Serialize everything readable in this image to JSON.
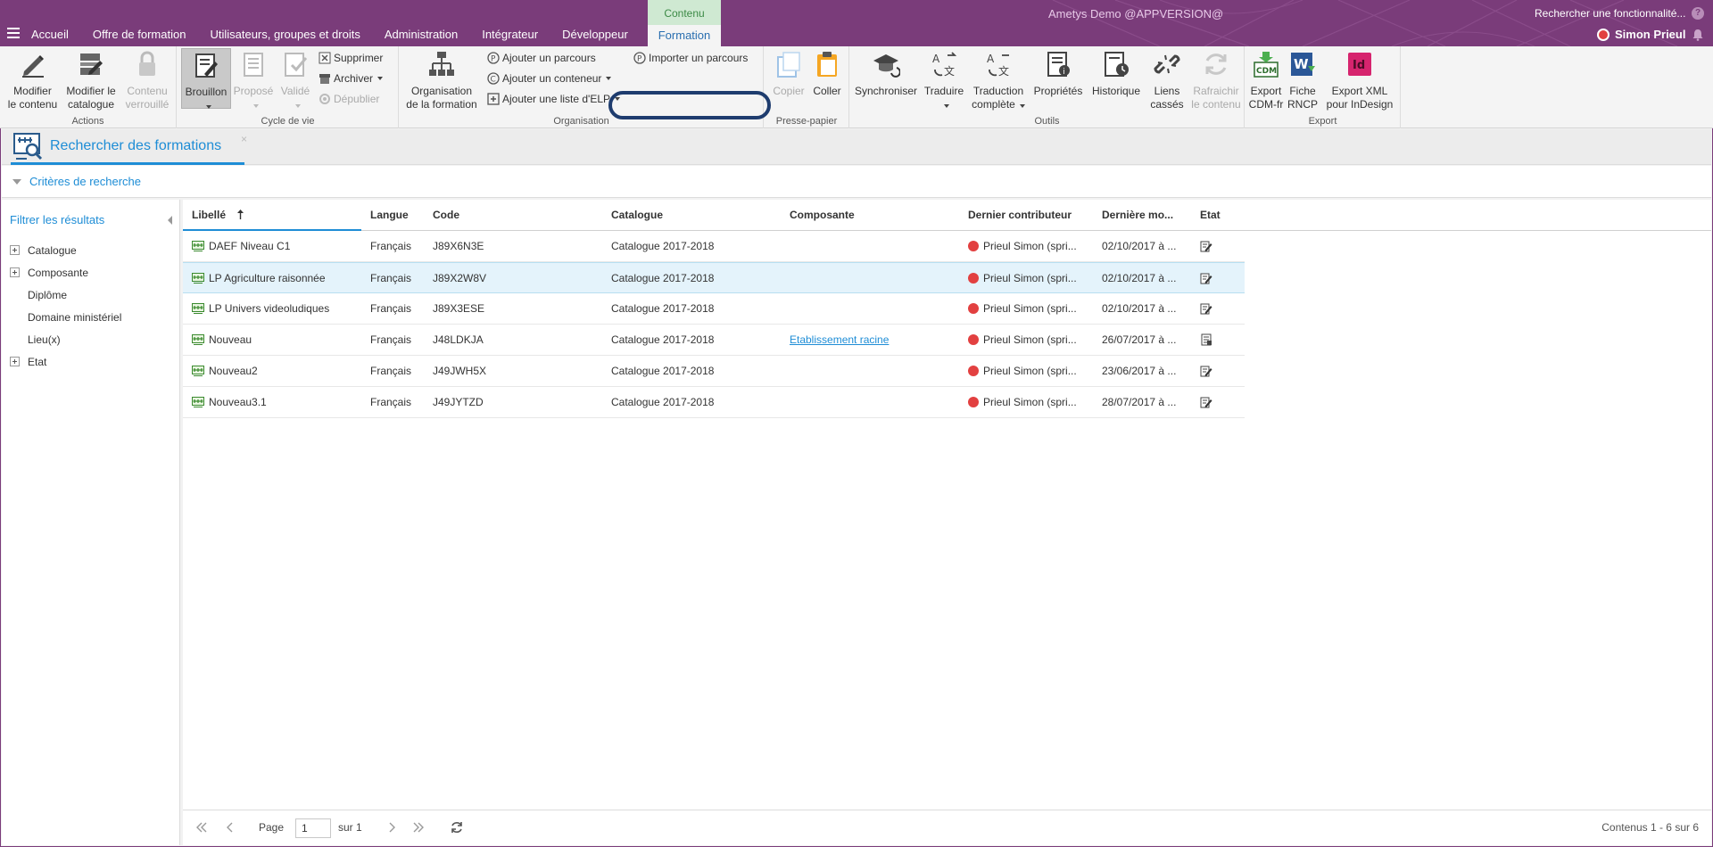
{
  "topbar": {
    "nav": [
      "Accueil",
      "Offre de formation",
      "Utilisateurs, groupes et droits",
      "Administration",
      "Intégrateur",
      "Développeur"
    ],
    "context_group": "Contenu",
    "context_tab": "Formation",
    "app_title": "Ametys Demo @APPVERSION@",
    "search_feature": "Rechercher une fonctionnalité...",
    "help": "?",
    "user": "Simon Prieul",
    "brand_color": "#7a3c7a"
  },
  "ribbon": {
    "actions": {
      "label": "Actions",
      "modify_content": [
        "Modifier",
        "le contenu"
      ],
      "modify_catalog": [
        "Modifier le",
        "catalogue"
      ],
      "locked_content": [
        "Contenu",
        "verrouillé"
      ]
    },
    "lifecycle": {
      "label": "Cycle de vie",
      "draft": "Brouillon",
      "proposed": "Proposé",
      "validated": "Validé",
      "delete": "Supprimer",
      "archive": "Archiver",
      "unpublish": "Dépublier"
    },
    "organisation": {
      "label": "Organisation",
      "org": [
        "Organisation",
        "de la formation"
      ],
      "add_path": "Ajouter un parcours",
      "import_path": "Importer un parcours",
      "add_container": "Ajouter un conteneur",
      "add_elp_list": "Ajouter une liste d'ELP"
    },
    "clipboard": {
      "label": "Presse-papier",
      "copy": "Copier",
      "paste": "Coller"
    },
    "tools": {
      "label": "Outils",
      "sync": "Synchroniser",
      "translate": "Traduire",
      "full_translation": [
        "Traduction",
        "complète"
      ],
      "properties": "Propriétés",
      "history": "Historique",
      "broken_links": [
        "Liens",
        "cassés"
      ],
      "refresh": [
        "Rafraichir",
        "le contenu"
      ]
    },
    "export": {
      "label": "Export",
      "cdm": [
        "Export",
        "CDM-fr"
      ],
      "rncp": [
        "Fiche",
        "RNCP"
      ],
      "indesign": [
        "Export XML",
        "pour InDesign"
      ]
    }
  },
  "tool": {
    "title": "Rechercher des formations",
    "close": "×"
  },
  "criteria": "Critères de recherche",
  "filter": {
    "title": "Filtrer les résultats",
    "items": [
      {
        "label": "Catalogue",
        "expandable": true
      },
      {
        "label": "Composante",
        "expandable": true
      },
      {
        "label": "Diplôme",
        "expandable": false
      },
      {
        "label": "Domaine ministériel",
        "expandable": false
      },
      {
        "label": "Lieu(x)",
        "expandable": false
      },
      {
        "label": "Etat",
        "expandable": true
      }
    ]
  },
  "grid": {
    "columns": [
      "Libellé",
      "Langue",
      "Code",
      "Catalogue",
      "Composante",
      "Dernier contributeur",
      "Dernière mo...",
      "Etat"
    ],
    "rows": [
      [
        "DAEF Niveau C1",
        "Français",
        "J89X6N3E",
        "Catalogue 2017-2018",
        "",
        "Prieul Simon (spri...",
        "02/10/2017 à ...",
        "edit"
      ],
      [
        "LP Agriculture raisonnée",
        "Français",
        "J89X2W8V",
        "Catalogue 2017-2018",
        "",
        "Prieul Simon (spri...",
        "02/10/2017 à ...",
        "edit"
      ],
      [
        "LP Univers videoludiques",
        "Français",
        "J89X3ESE",
        "Catalogue 2017-2018",
        "",
        "Prieul Simon (spri...",
        "02/10/2017 à ...",
        "edit"
      ],
      [
        "Nouveau",
        "Français",
        "J48LDKJA",
        "Catalogue 2017-2018",
        "Etablissement racine",
        "Prieul Simon (spri...",
        "26/07/2017 à ...",
        "doc"
      ],
      [
        "Nouveau2",
        "Français",
        "J49JWH5X",
        "Catalogue 2017-2018",
        "",
        "Prieul Simon (spri...",
        "23/06/2017 à ...",
        "edit"
      ],
      [
        "Nouveau3.1",
        "Français",
        "J49JYTZD",
        "Catalogue 2017-2018",
        "",
        "Prieul Simon (spri...",
        "28/07/2017 à ...",
        "edit"
      ]
    ],
    "selected_row": 1
  },
  "pager": {
    "page_label": "Page",
    "page": "1",
    "of": "sur 1",
    "summary": "Contenus 1 - 6 sur 6"
  }
}
